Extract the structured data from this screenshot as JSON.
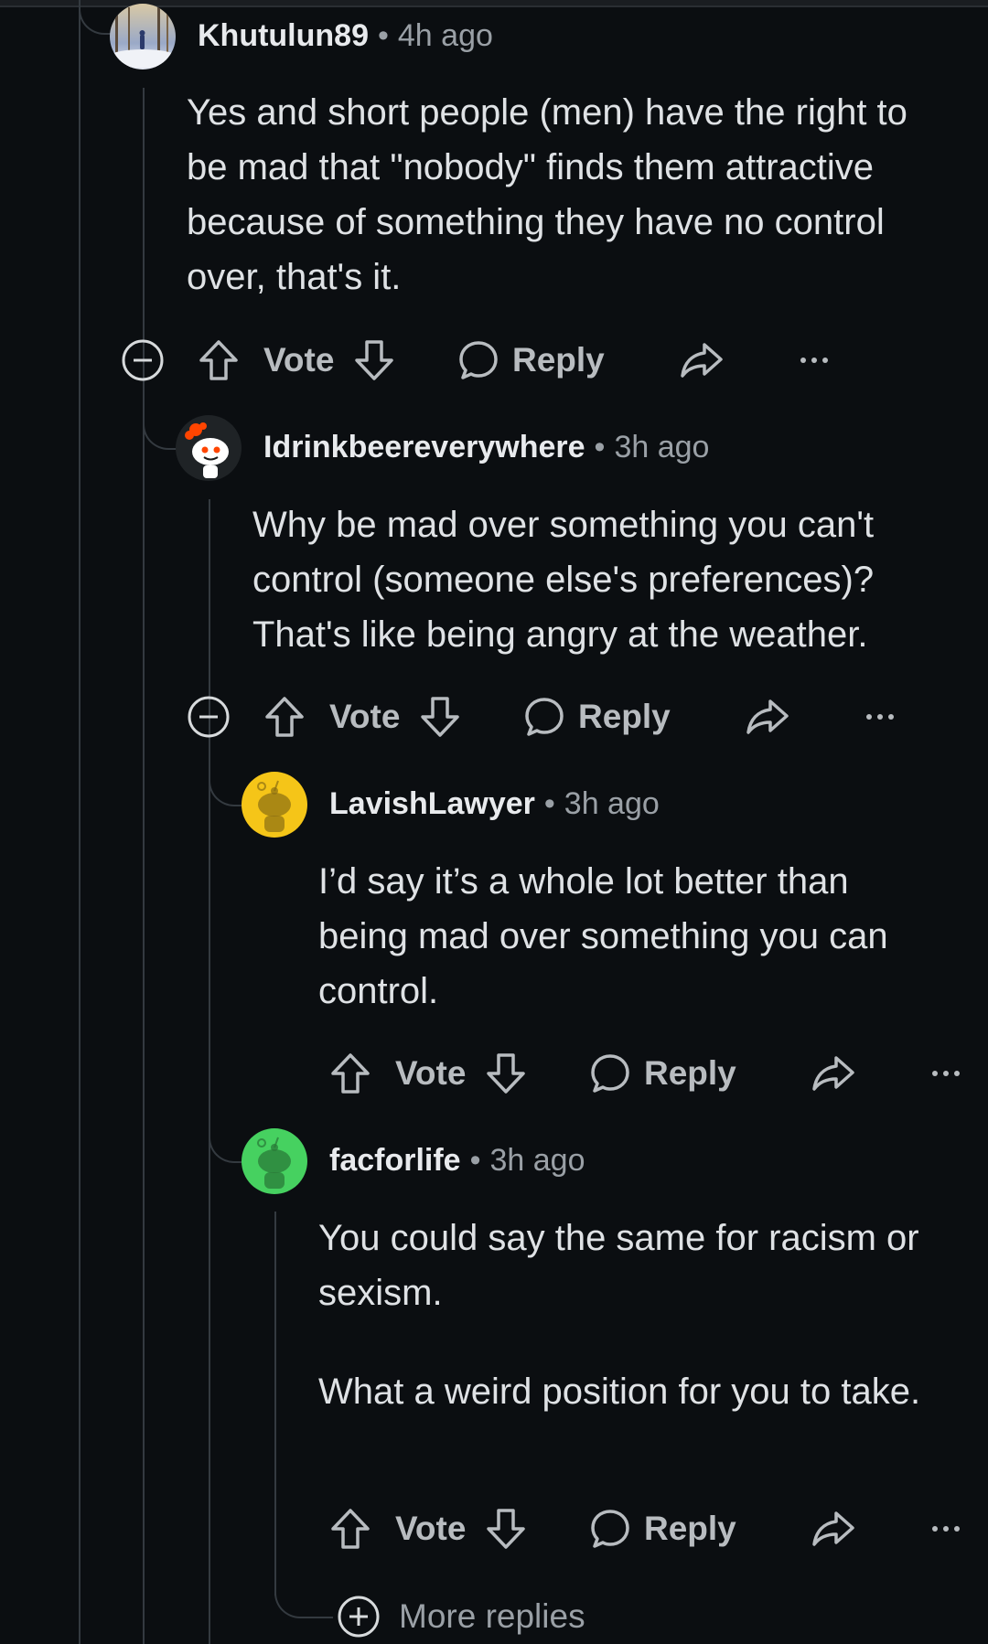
{
  "comments": [
    {
      "username": "Khutulun89",
      "time": "4h ago",
      "paragraphs": [
        "Yes and short people (men) have the right to be mad that \"nobody\" finds them attractive because of something they have no control over, that's it."
      ],
      "actions": {
        "vote": "Vote",
        "reply": "Reply"
      }
    },
    {
      "username": "Idrinkbeereverywhere",
      "time": "3h ago",
      "paragraphs": [
        "Why be mad over something you can't control (someone else's preferences)? That's like being angry at the weather."
      ],
      "actions": {
        "vote": "Vote",
        "reply": "Reply"
      }
    },
    {
      "username": "LavishLawyer",
      "time": "3h ago",
      "paragraphs": [
        "I’d say it’s a whole lot better than being mad over something you can control."
      ],
      "actions": {
        "vote": "Vote",
        "reply": "Reply"
      }
    },
    {
      "username": "facforlife",
      "time": "3h ago",
      "paragraphs": [
        "You could say the same for racism or sexism.",
        "What a weird position for you to take."
      ],
      "actions": {
        "vote": "Vote",
        "reply": "Reply"
      }
    }
  ],
  "more_replies": "More replies",
  "colors": {
    "background": "#0b0e11",
    "text": "#dfe2e5",
    "muted": "#9aa0a6",
    "thread_line": "#343a40",
    "avatar_yellow": "#f5c518",
    "avatar_green": "#46d160"
  },
  "icons": [
    "collapse-icon",
    "upvote-icon",
    "downvote-icon",
    "comment-bubble-icon",
    "share-icon",
    "more-options-icon",
    "expand-icon"
  ]
}
